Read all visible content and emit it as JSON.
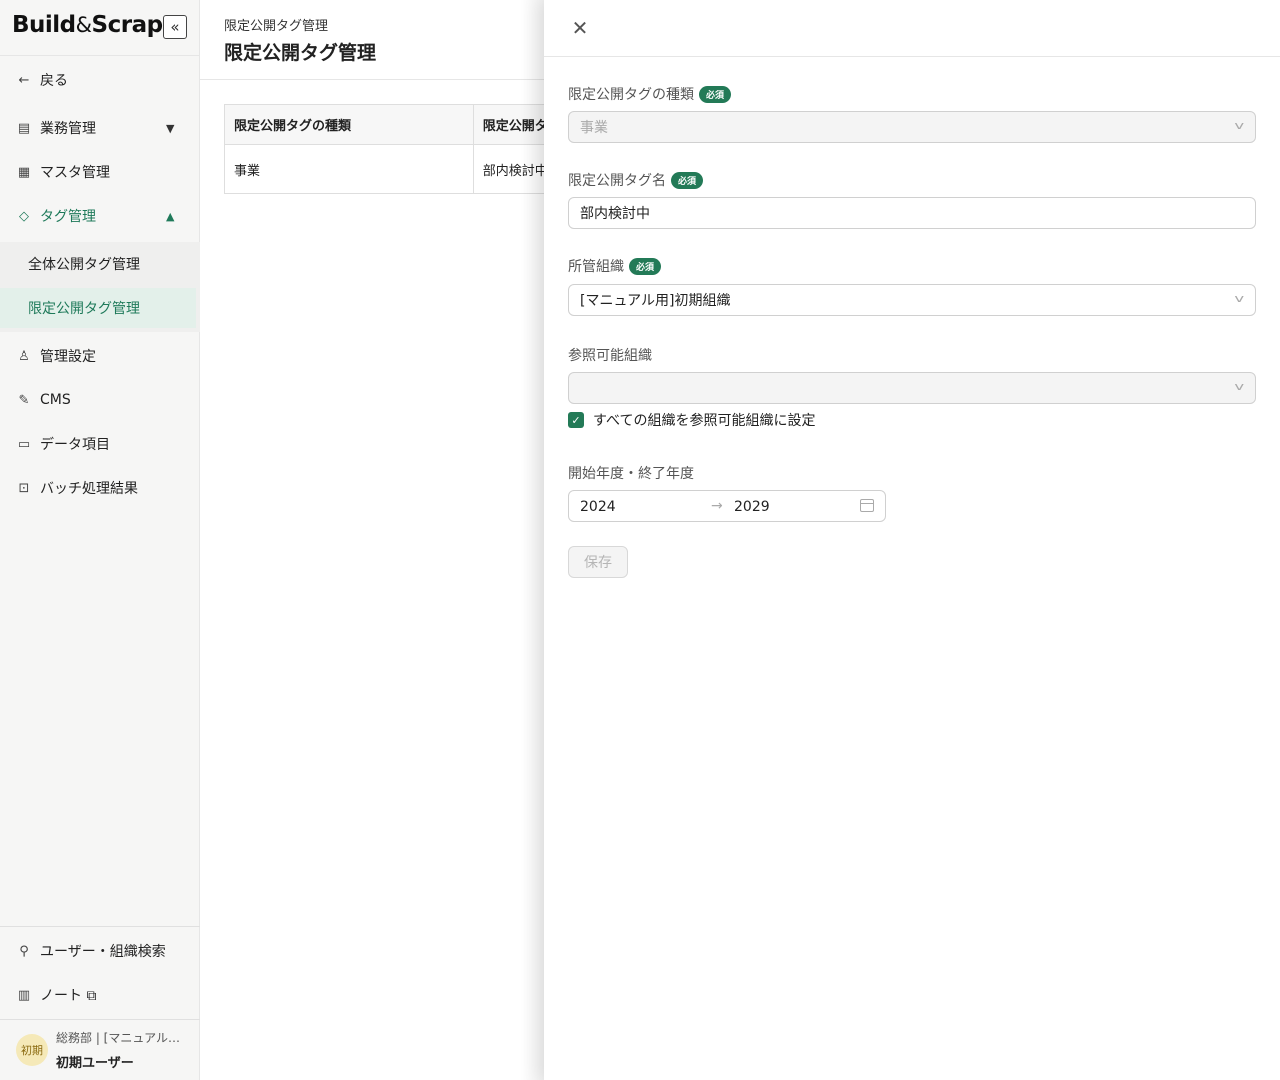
{
  "sidebar": {
    "logo": {
      "build": "Build",
      "amp": "&",
      "scrap": "Scrap"
    },
    "back_label": "戻る",
    "items": [
      {
        "label": "業務管理",
        "chevron": "⌄"
      },
      {
        "label": "マスタ管理"
      },
      {
        "label": "タグ管理",
        "chevron": "⌃"
      },
      {
        "label": "管理設定"
      },
      {
        "label": "CMS"
      },
      {
        "label": "データ項目"
      },
      {
        "label": "バッチ処理結果"
      }
    ],
    "sub_items": [
      {
        "label": "全体公開タグ管理"
      },
      {
        "label": "限定公開タグ管理"
      }
    ],
    "bottom_items": [
      {
        "label": "ユーザー・組織検索"
      },
      {
        "label": "ノート"
      }
    ],
    "user": {
      "avatar": "初期",
      "org": "総務部 | [マニュアル…",
      "name": "初期ユーザー"
    }
  },
  "header": {
    "breadcrumb": "限定公開タグ管理",
    "title": "限定公開タグ管理"
  },
  "table": {
    "columns": [
      "限定公開タグの種類",
      "限定公開タ"
    ],
    "rows": [
      [
        "事業",
        "部内検討中"
      ]
    ]
  },
  "drawer": {
    "required_badge": "必須",
    "fields": {
      "tag_type": {
        "label": "限定公開タグの種類",
        "value": "事業"
      },
      "tag_name": {
        "label": "限定公開タグ名",
        "value": "部内検討中"
      },
      "owner_org": {
        "label": "所管組織",
        "value": "[マニュアル用]初期組織"
      },
      "ref_org": {
        "label": "参照可能組織",
        "value": ""
      },
      "all_orgs_checkbox": {
        "label": "すべての組織を参照可能組織に設定",
        "checked": true
      },
      "years": {
        "label": "開始年度・終了年度",
        "from": "2024",
        "to": "2029"
      }
    },
    "save_label": "保存"
  },
  "colors": {
    "accent": "#237a57",
    "accent_bg": "#e3f0ea"
  }
}
